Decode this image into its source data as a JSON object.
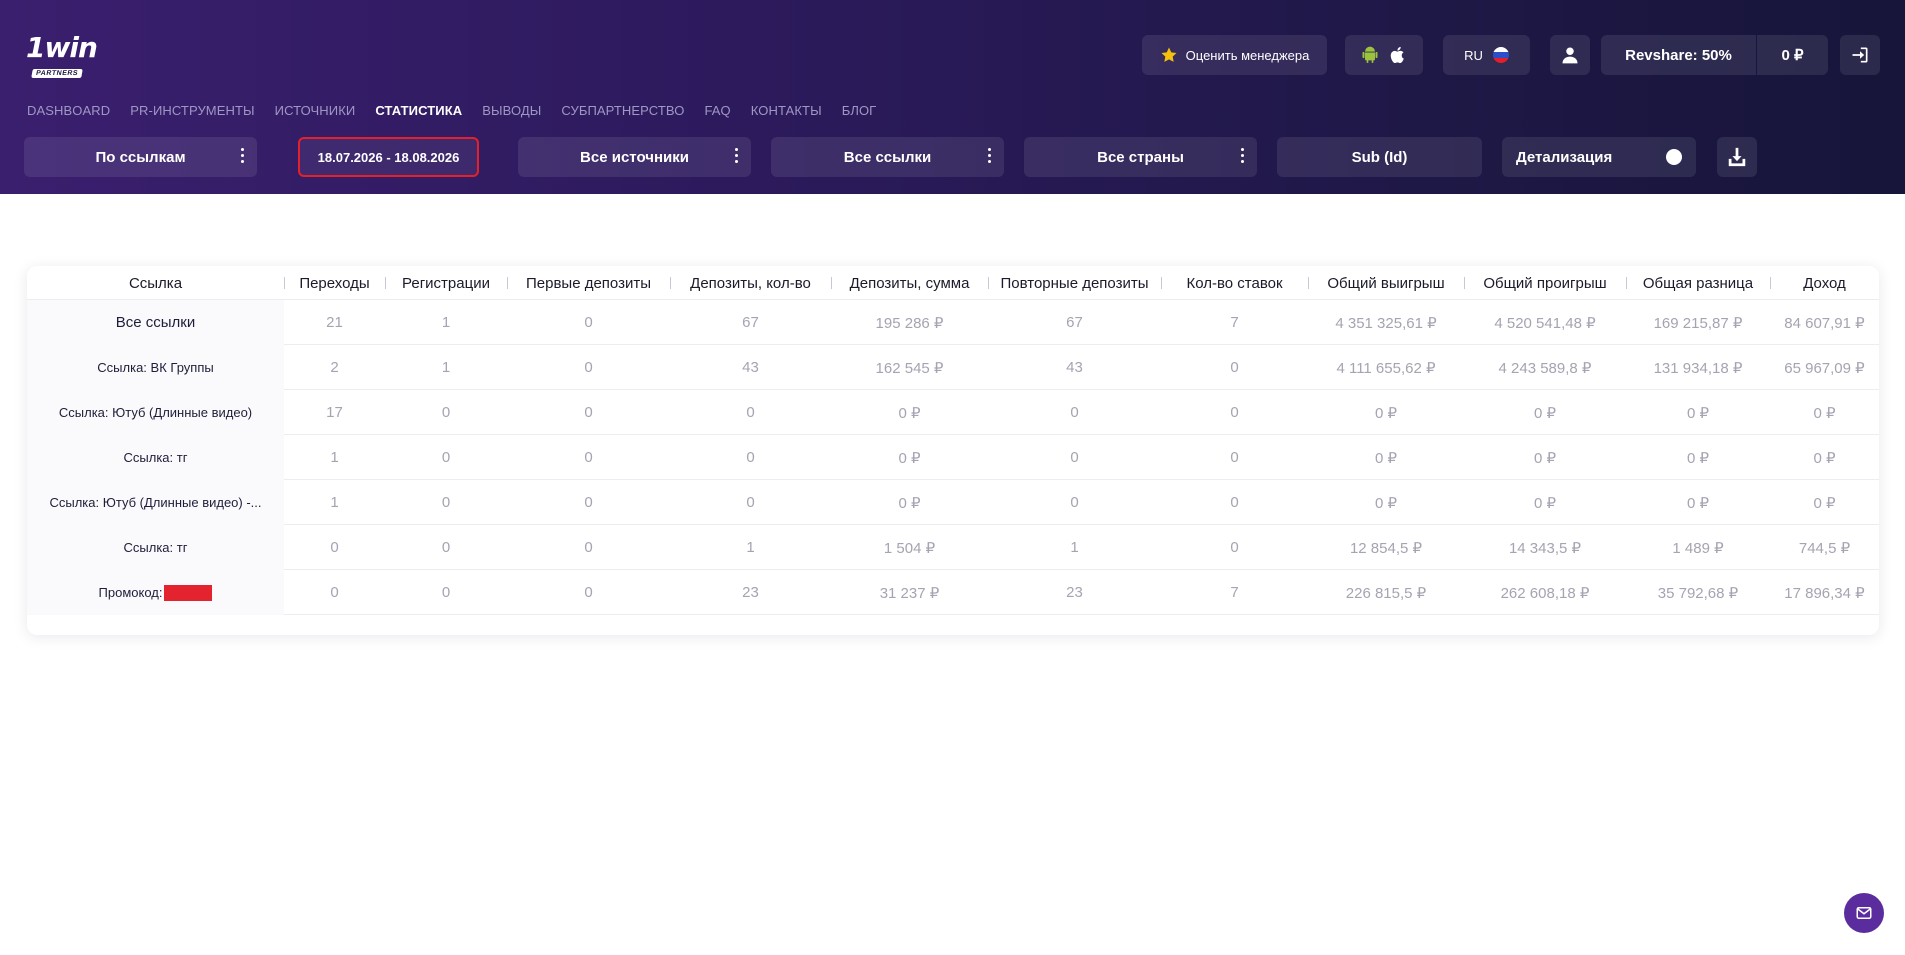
{
  "brand": {
    "logo_main": "1win",
    "logo_sub": "PARTNERS"
  },
  "topbar": {
    "rate_manager": "Оценить менеджера",
    "lang": "RU",
    "revshare": "Revshare: 50%",
    "balance": "0 ₽"
  },
  "nav": [
    {
      "label": "DASHBOARD"
    },
    {
      "label": "PR-ИНСТРУМЕНТЫ"
    },
    {
      "label": "ИСТОЧНИКИ"
    },
    {
      "label": "СТАТИСТИКА",
      "active": true
    },
    {
      "label": "ВЫВОДЫ"
    },
    {
      "label": "СУБПАРТНЕРСТВО"
    },
    {
      "label": "FAQ"
    },
    {
      "label": "КОНТАКТЫ"
    },
    {
      "label": "БЛОГ"
    }
  ],
  "filters": {
    "group_by": "По ссылкам",
    "date_range": "18.07.2026 - 18.08.2026",
    "sources": "Все источники",
    "links": "Все ссылки",
    "countries": "Все страны",
    "sub": "Sub (Id)",
    "detail": "Детализация"
  },
  "table": {
    "headers": [
      "Ссылка",
      "Переходы",
      "Регистрации",
      "Первые депозиты",
      "Депозиты, кол-во",
      "Депозиты, сумма",
      "Повторные депозиты",
      "Кол-во ставок",
      "Общий выигрыш",
      "Общий проигрыш",
      "Общая разница",
      "Доход"
    ],
    "rows": [
      [
        "Все ссылки",
        "21",
        "1",
        "0",
        "67",
        "195 286 ₽",
        "67",
        "7",
        "4 351 325,61 ₽",
        "4 520 541,48 ₽",
        "169 215,87 ₽",
        "84 607,91 ₽"
      ],
      [
        "Ссылка: ВК Группы",
        "2",
        "1",
        "0",
        "43",
        "162 545 ₽",
        "43",
        "0",
        "4 111 655,62 ₽",
        "4 243 589,8 ₽",
        "131 934,18 ₽",
        "65 967,09 ₽"
      ],
      [
        "Ссылка: Ютуб (Длинные видео)",
        "17",
        "0",
        "0",
        "0",
        "0 ₽",
        "0",
        "0",
        "0 ₽",
        "0 ₽",
        "0 ₽",
        "0 ₽"
      ],
      [
        "Ссылка: тг",
        "1",
        "0",
        "0",
        "0",
        "0 ₽",
        "0",
        "0",
        "0 ₽",
        "0 ₽",
        "0 ₽",
        "0 ₽"
      ],
      [
        "Ссылка: Ютуб (Длинные видео) -...",
        "1",
        "0",
        "0",
        "0",
        "0 ₽",
        "0",
        "0",
        "0 ₽",
        "0 ₽",
        "0 ₽",
        "0 ₽"
      ],
      [
        "Ссылка: тг",
        "0",
        "0",
        "0",
        "1",
        "1 504 ₽",
        "1",
        "0",
        "12 854,5 ₽",
        "14 343,5 ₽",
        "1 489 ₽",
        "744,5 ₽"
      ],
      [
        "Промокод:",
        "0",
        "0",
        "0",
        "23",
        "31 237 ₽",
        "23",
        "7",
        "226 815,5 ₽",
        "262 608,18 ₽",
        "35 792,68 ₽",
        "17 896,34 ₽"
      ]
    ]
  },
  "colors": {
    "accent_red": "#e5202a",
    "header_start": "#3a1f6e",
    "header_end": "#17153a",
    "chat": "#5b2c9e"
  },
  "icons": [
    "star-icon",
    "android-icon",
    "apple-icon",
    "ru-flag-icon",
    "user-icon",
    "logout-icon",
    "kebab-icon",
    "download-icon",
    "mail-icon"
  ]
}
